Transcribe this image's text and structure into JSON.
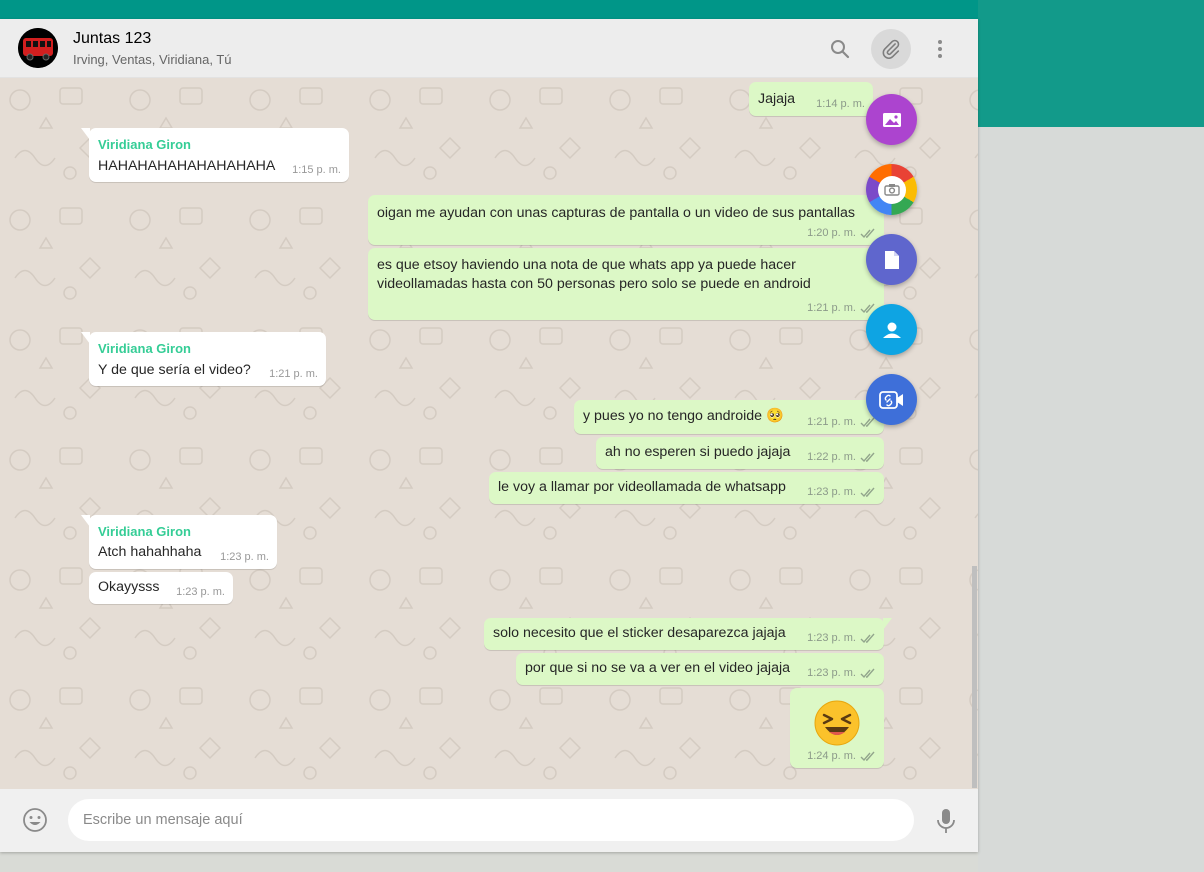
{
  "header": {
    "title": "Juntas 123",
    "members": "Irving, Ventas, Viridiana, Tú"
  },
  "messages": [
    {
      "dir": "out",
      "text": "Jajaja",
      "time": "1:14 p. m."
    },
    {
      "dir": "in",
      "sender": "Viridiana Giron",
      "text": "HAHAHAHAHAHAHAHAHA",
      "time": "1:15 p. m."
    },
    {
      "dir": "out",
      "text": "oigan me ayudan con unas capturas de pantalla o un video de sus pantallas",
      "time": "1:20 p. m."
    },
    {
      "dir": "out",
      "text": [
        "es que etsoy haviendo una nota de que whats app ya puede hacer",
        "videollamadas hasta con 50 personas pero solo se puede en android"
      ],
      "time": "1:21 p. m."
    },
    {
      "dir": "in",
      "sender": "Viridiana Giron",
      "text": "Y de que sería el video?",
      "time": "1:21 p. m."
    },
    {
      "dir": "out",
      "text": "y pues yo no tengo androide 🥺",
      "time": "1:21 p. m."
    },
    {
      "dir": "out",
      "text": "ah no esperen si puedo jajaja",
      "time": "1:22 p. m."
    },
    {
      "dir": "out",
      "text": "le voy a llamar por videollamada de whatsapp",
      "time": "1:23 p. m."
    },
    {
      "dir": "in",
      "sender": "Viridiana Giron",
      "text": "Atch hahahhaha",
      "time": "1:23 p. m."
    },
    {
      "dir": "in",
      "text": "Okayysss",
      "time": "1:23 p. m."
    },
    {
      "dir": "out",
      "text": "solo necesito que el sticker desaparezca jajaja",
      "time": "1:23 p. m."
    },
    {
      "dir": "out",
      "text": "por que si no se va a ver en el video jajaja",
      "time": "1:23 p. m."
    },
    {
      "dir": "out",
      "emoji": "laughing-face",
      "time": "1:24 p. m."
    }
  ],
  "attach_menu": [
    {
      "icon": "image-icon",
      "color": "#ac44cf"
    },
    {
      "icon": "camera-icon",
      "color": "multicolor"
    },
    {
      "icon": "document-icon",
      "color": "#5f66cd"
    },
    {
      "icon": "contact-icon",
      "color": "#0ea4e3"
    },
    {
      "icon": "video-room-icon",
      "color": "#3e6fd9"
    }
  ],
  "footer": {
    "placeholder": "Escribe un mensaje aquí"
  },
  "colors": {
    "top_bar": "#009688",
    "outgoing_bubble": "#dcf8c6",
    "incoming_bubble": "#ffffff",
    "sender_name": "#35cd96",
    "chat_background": "#e5ddd5"
  }
}
